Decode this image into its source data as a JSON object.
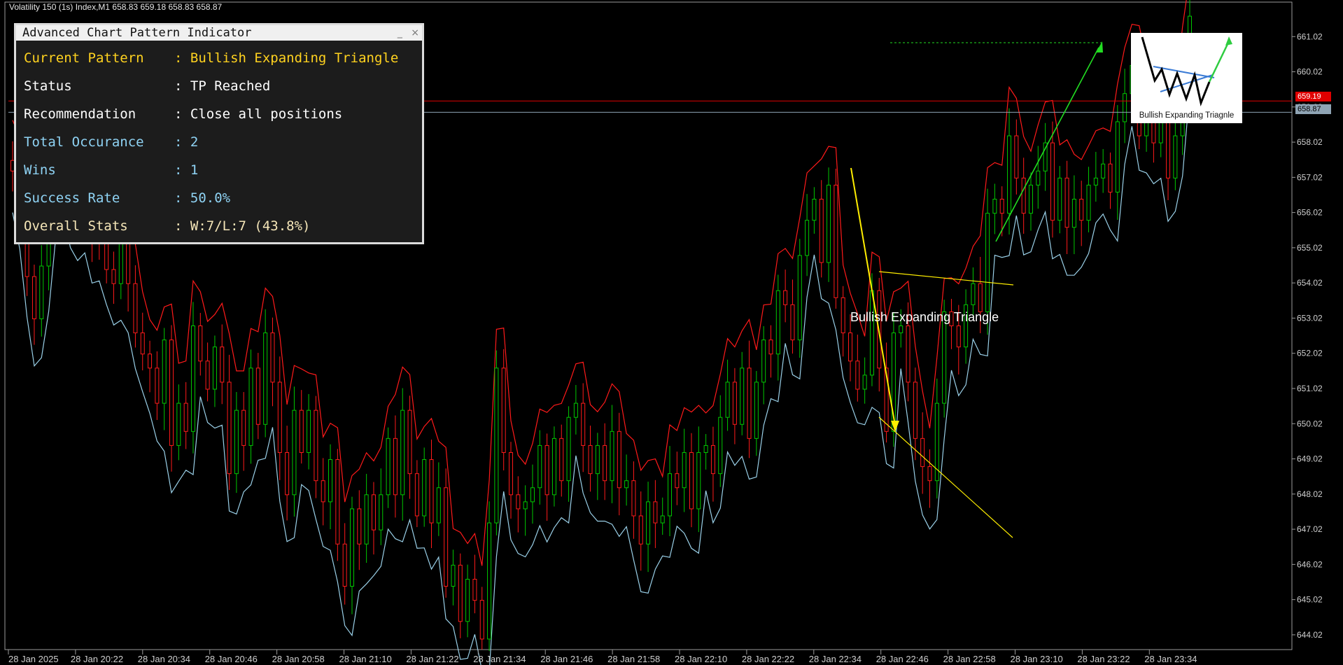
{
  "header": {
    "symbol_info": "Volatility 150 (1s) Index,M1  658.83 659.18 658.83 658.87"
  },
  "panel": {
    "title": "Advanced Chart Pattern Indicator",
    "minimize_label": "_",
    "close_label": "×",
    "rows": [
      {
        "key": "Current Pattern",
        "sep": ": ",
        "value": "Bullish Expanding Triangle",
        "color": "#ffd21f"
      },
      {
        "key": "Status",
        "sep": ": ",
        "value": "TP Reached",
        "color": "#ffffff"
      },
      {
        "key": "Recommendation",
        "sep": ": ",
        "value": "Close all positions",
        "color": "#ffffff"
      },
      {
        "key": "Total Occurance",
        "sep": ": ",
        "value": "2",
        "color": "#8fd3f4"
      },
      {
        "key": "Wins",
        "sep": ": ",
        "value": "1",
        "color": "#8fd3f4"
      },
      {
        "key": "Success Rate",
        "sep": ": ",
        "value": "50.0%",
        "color": "#8fd3f4"
      },
      {
        "key": "Overall Stats",
        "sep": ": ",
        "value": "W:7/L:7 (43.8%)",
        "color": "#f5e6b8"
      }
    ]
  },
  "pattern_label": "Bullish Expanding Triangle",
  "thumbnail_caption": "Bullish Expanding Triagnle",
  "price_tags": [
    {
      "text": "659.19",
      "bg": "#e00000",
      "fg": "#ffffff"
    },
    {
      "text": "658.87",
      "bg": "#8fa4b4",
      "fg": "#000000"
    }
  ],
  "colors": {
    "bear_outline": "#ff1a1a",
    "bull_outline": "#00c800",
    "envelope_upper": "#ff1a1a",
    "envelope_lower": "#9ad0e8",
    "pattern_line": "#ffee00",
    "target_arrow": "#22dd22"
  },
  "chart_data": {
    "type": "candlestick",
    "ylim": [
      643.6,
      662.0
    ],
    "y_ticks": [
      661.02,
      660.02,
      659.02,
      658.02,
      657.02,
      656.02,
      655.02,
      654.02,
      653.02,
      652.02,
      651.02,
      650.02,
      649.02,
      648.02,
      647.02,
      646.02,
      645.02,
      644.02
    ],
    "x_ticks": [
      "28 Jan 2025",
      "28 Jan 20:22",
      "28 Jan 20:34",
      "28 Jan 20:46",
      "28 Jan 20:58",
      "28 Jan 21:10",
      "28 Jan 21:22",
      "28 Jan 21:34",
      "28 Jan 21:46",
      "28 Jan 21:58",
      "28 Jan 22:10",
      "28 Jan 22:22",
      "28 Jan 22:34",
      "28 Jan 22:46",
      "28 Jan 22:58",
      "28 Jan 23:10",
      "28 Jan 23:22",
      "28 Jan 23:34"
    ],
    "bid_line": 659.19,
    "ask_line": 658.87,
    "last_values": {
      "open": 658.83,
      "high": 659.18,
      "low": 658.83,
      "close": 658.87
    },
    "series": [
      {
        "name": "price",
        "values": [
          657.2,
          656.0,
          654.2,
          653.0,
          654.5,
          656.3,
          657.0,
          657.5,
          656.0,
          655.8,
          656.0,
          655.4,
          655.2,
          654.4,
          654.0,
          655.6,
          654.0,
          652.6,
          652.0,
          651.6,
          650.6,
          652.4,
          649.4,
          650.6,
          649.8,
          652.8,
          651.8,
          651.0,
          652.2,
          651.2,
          648.6,
          650.4,
          649.4,
          651.6,
          650.0,
          652.6,
          651.2,
          649.2,
          648.0,
          650.4,
          649.2,
          650.4,
          648.4,
          647.8,
          649.0,
          646.6,
          645.4,
          647.6,
          646.6,
          648.0,
          647.0,
          648.0,
          649.6,
          648.0,
          650.4,
          648.6,
          647.4,
          649.0,
          647.2,
          648.2,
          645.4,
          646.0,
          644.4,
          645.6,
          645.0,
          643.9,
          647.2,
          651.6,
          649.2,
          648.0,
          647.6,
          647.8,
          648.2,
          649.4,
          648.0,
          649.6,
          648.4,
          650.2,
          650.6,
          649.4,
          648.6,
          649.4,
          648.4,
          649.8,
          648.2,
          648.4,
          647.4,
          646.6,
          647.8,
          647.2,
          647.4,
          648.6,
          648.2,
          649.2,
          647.6,
          649.2,
          649.4,
          648.6,
          650.2,
          651.2,
          650.0,
          651.6,
          649.6,
          651.2,
          652.4,
          652.0,
          653.8,
          653.4,
          652.4,
          654.8,
          655.8,
          656.4,
          654.6,
          656.8,
          653.6,
          652.6,
          651.8,
          651.0,
          651.4,
          653.8,
          651.6,
          649.8,
          652.6,
          652.8,
          651.2,
          649.6,
          648.8,
          648.4,
          650.6,
          653.2,
          652.8,
          652.2,
          653.4,
          654.0,
          653.2,
          656.0,
          656.4,
          656.0,
          658.2,
          657.0,
          656.0,
          656.8,
          657.2,
          658.0,
          655.8,
          657.0,
          655.6,
          656.4,
          655.8,
          656.8,
          657.0,
          657.4,
          656.6,
          658.6,
          659.4,
          660.2,
          658.2,
          659.2,
          658.0,
          659.4,
          657.0,
          658.2,
          660.4,
          661.6
        ]
      }
    ]
  }
}
